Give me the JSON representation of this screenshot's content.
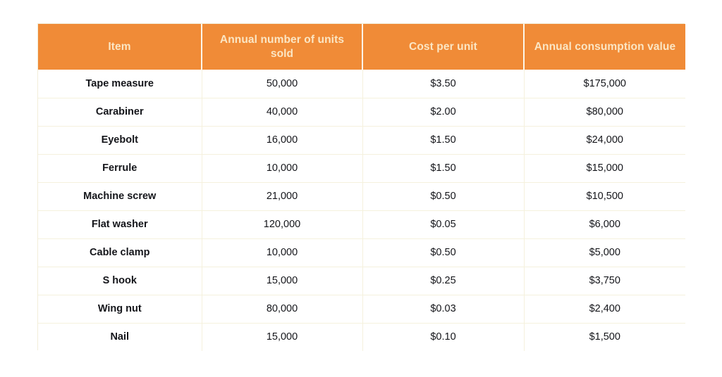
{
  "table": {
    "columns": [
      {
        "key": "item",
        "label": "Item"
      },
      {
        "key": "units",
        "label": "Annual number of units sold"
      },
      {
        "key": "cost",
        "label": "Cost per unit"
      },
      {
        "key": "value",
        "label": "Annual consumption value"
      }
    ],
    "rows": [
      {
        "item": "Tape measure",
        "units": "50,000",
        "cost": "$3.50",
        "value": "$175,000"
      },
      {
        "item": "Carabiner",
        "units": "40,000",
        "cost": "$2.00",
        "value": "$80,000"
      },
      {
        "item": "Eyebolt",
        "units": "16,000",
        "cost": "$1.50",
        "value": "$24,000"
      },
      {
        "item": "Ferrule",
        "units": "10,000",
        "cost": "$1.50",
        "value": "$15,000"
      },
      {
        "item": "Machine screw",
        "units": "21,000",
        "cost": "$0.50",
        "value": "$10,500"
      },
      {
        "item": "Flat washer",
        "units": "120,000",
        "cost": "$0.05",
        "value": "$6,000"
      },
      {
        "item": "Cable clamp",
        "units": "10,000",
        "cost": "$0.50",
        "value": "$5,000"
      },
      {
        "item": "S hook",
        "units": "15,000",
        "cost": "$0.25",
        "value": "$3,750"
      },
      {
        "item": "Wing nut",
        "units": "80,000",
        "cost": "$0.03",
        "value": "$2,400"
      },
      {
        "item": "Nail",
        "units": "15,000",
        "cost": "$0.10",
        "value": "$1,500"
      }
    ]
  },
  "colors": {
    "header_background": "#f08b37",
    "header_text": "#fbe6c4",
    "cell_text": "#14151a",
    "grid_line": "#f5f1dd",
    "page_background": "#ffffff"
  }
}
